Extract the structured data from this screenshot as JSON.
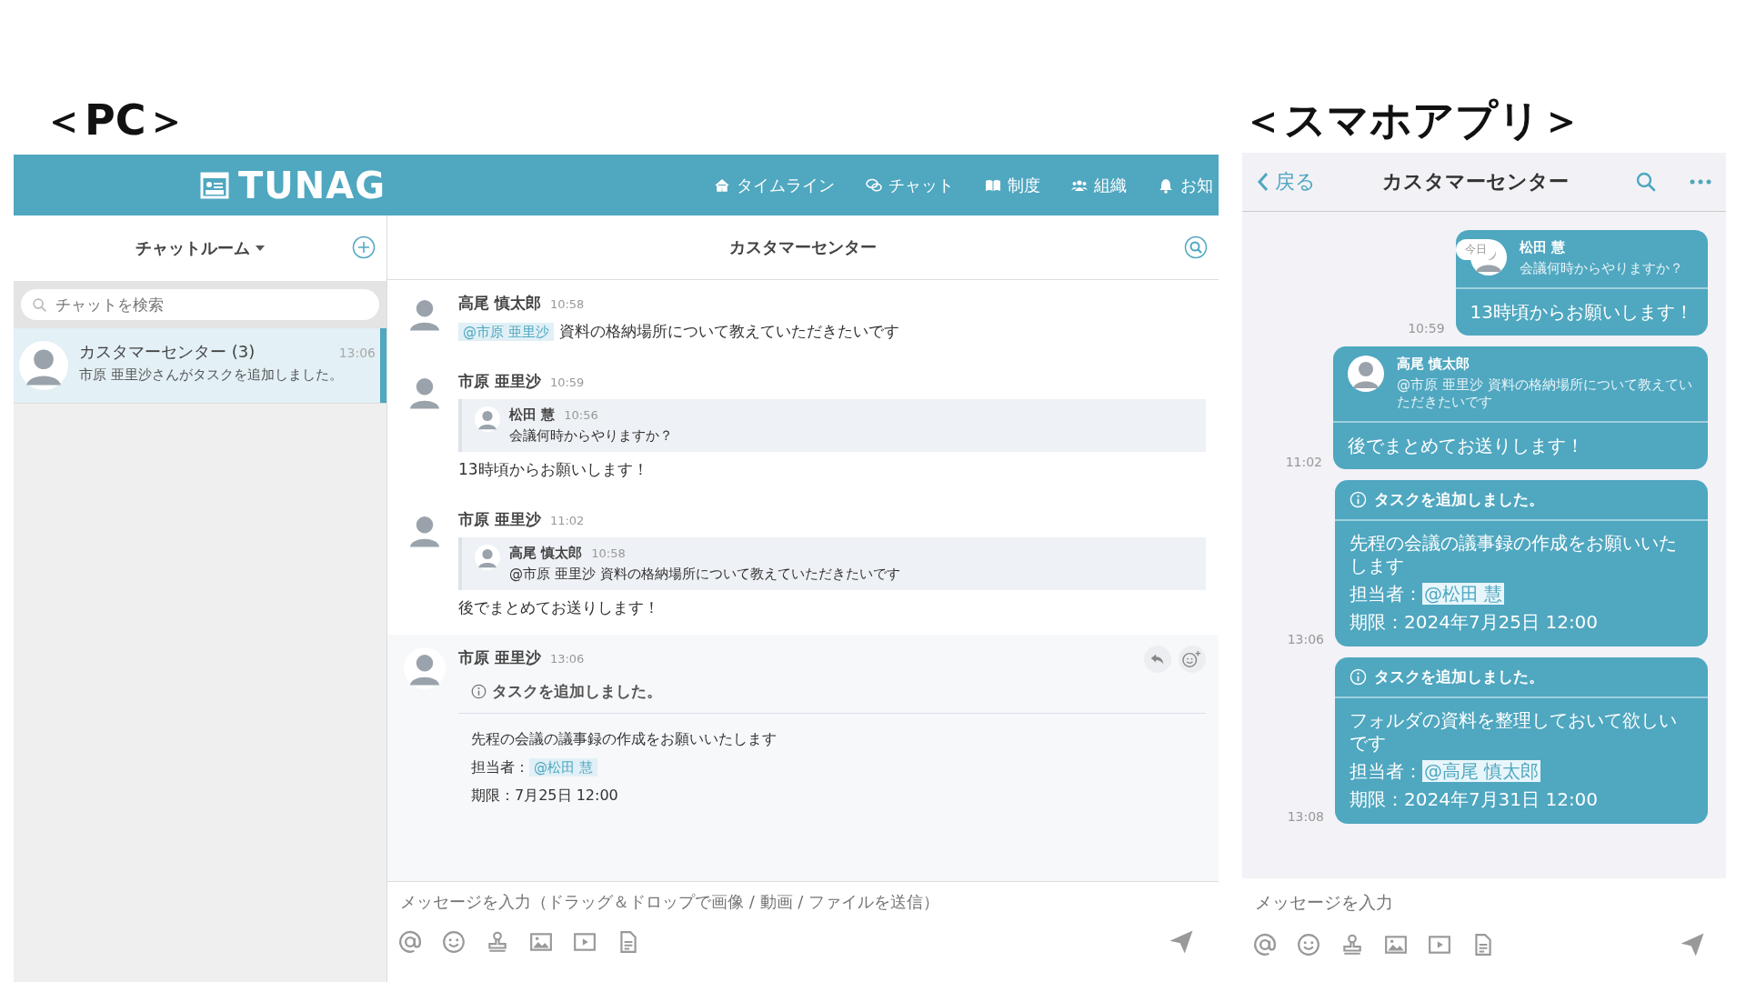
{
  "pc": {
    "label": "＜PC＞",
    "logo": "TUNAG",
    "nav": [
      {
        "label": "タイムライン"
      },
      {
        "label": "チャット"
      },
      {
        "label": "制度"
      },
      {
        "label": "組織"
      },
      {
        "label": "お知"
      }
    ],
    "sidebar": {
      "title": "チャットルーム",
      "search": {
        "placeholder": "チャットを検索"
      },
      "rooms": [
        {
          "name": "カスタマーセンター (3)",
          "time": "13:06",
          "preview": "市原 亜里沙さんがタスクを追加しました。",
          "selected": true
        }
      ]
    },
    "chat": {
      "title": "カスタマーセンター",
      "messages": [
        {
          "kind": "text",
          "author": "高尾 慎太郎",
          "time": "10:58",
          "mention": "@市原 亜里沙",
          "text": "資料の格納場所について教えていただきたいです",
          "hovered": false
        },
        {
          "kind": "reply",
          "author": "市原 亜里沙",
          "time": "10:59",
          "quote": {
            "author": "松田 慧",
            "time": "10:56",
            "text": "会議何時からやりますか？"
          },
          "text": "13時頃からお願いします！",
          "hovered": false
        },
        {
          "kind": "reply",
          "author": "市原 亜里沙",
          "time": "11:02",
          "quote": {
            "author": "高尾 慎太郎",
            "time": "10:58",
            "text": "@市原 亜里沙 資料の格納場所について教えていただきたいです"
          },
          "text": "後でまとめてお送りします！",
          "hovered": false
        },
        {
          "kind": "task",
          "author": "市原 亜里沙",
          "time": "13:06",
          "task": {
            "header": "タスクを追加しました。",
            "body": "先程の会議の議事録の作成をお願いいたします",
            "assignee_label": "担当者：",
            "assignee": "@松田 慧",
            "due": "期限：7月25日 12:00"
          },
          "hovered": true
        }
      ],
      "composer": {
        "placeholder": "メッセージを入力（ドラッグ＆ドロップで画像 / 動画 / ファイルを送信）"
      }
    }
  },
  "mobile": {
    "label": "＜スマホアプリ＞",
    "back": "戻る",
    "title": "カスタマーセンター",
    "date_badge": "今日",
    "messages": [
      {
        "kind": "reply",
        "time": "10:59",
        "quote": {
          "author": "松田 慧",
          "text": "会議何時からやりますか？"
        },
        "text": "13時頃からお願いします！"
      },
      {
        "kind": "reply",
        "time": "11:02",
        "quote": {
          "author": "高尾 慎太郎",
          "text": "@市原 亜里沙 資料の格納場所について教えていただきたいです"
        },
        "text": "後でまとめてお送りします！"
      },
      {
        "kind": "task",
        "time": "13:06",
        "task": {
          "header": "タスクを追加しました。",
          "body": "先程の会議の議事録の作成をお願いいたします",
          "assignee_label": "担当者：",
          "assignee": "@松田 慧",
          "due": "期限：2024年7月25日 12:00"
        }
      },
      {
        "kind": "task",
        "time": "13:08",
        "task": {
          "header": "タスクを追加しました。",
          "body": "フォルダの資料を整理しておいて欲しいです",
          "assignee_label": "担当者：",
          "assignee": "@高尾 慎太郎",
          "due": "期限：2024年7月31日 12:00"
        }
      }
    ],
    "composer": {
      "placeholder": "メッセージを入力"
    }
  }
}
